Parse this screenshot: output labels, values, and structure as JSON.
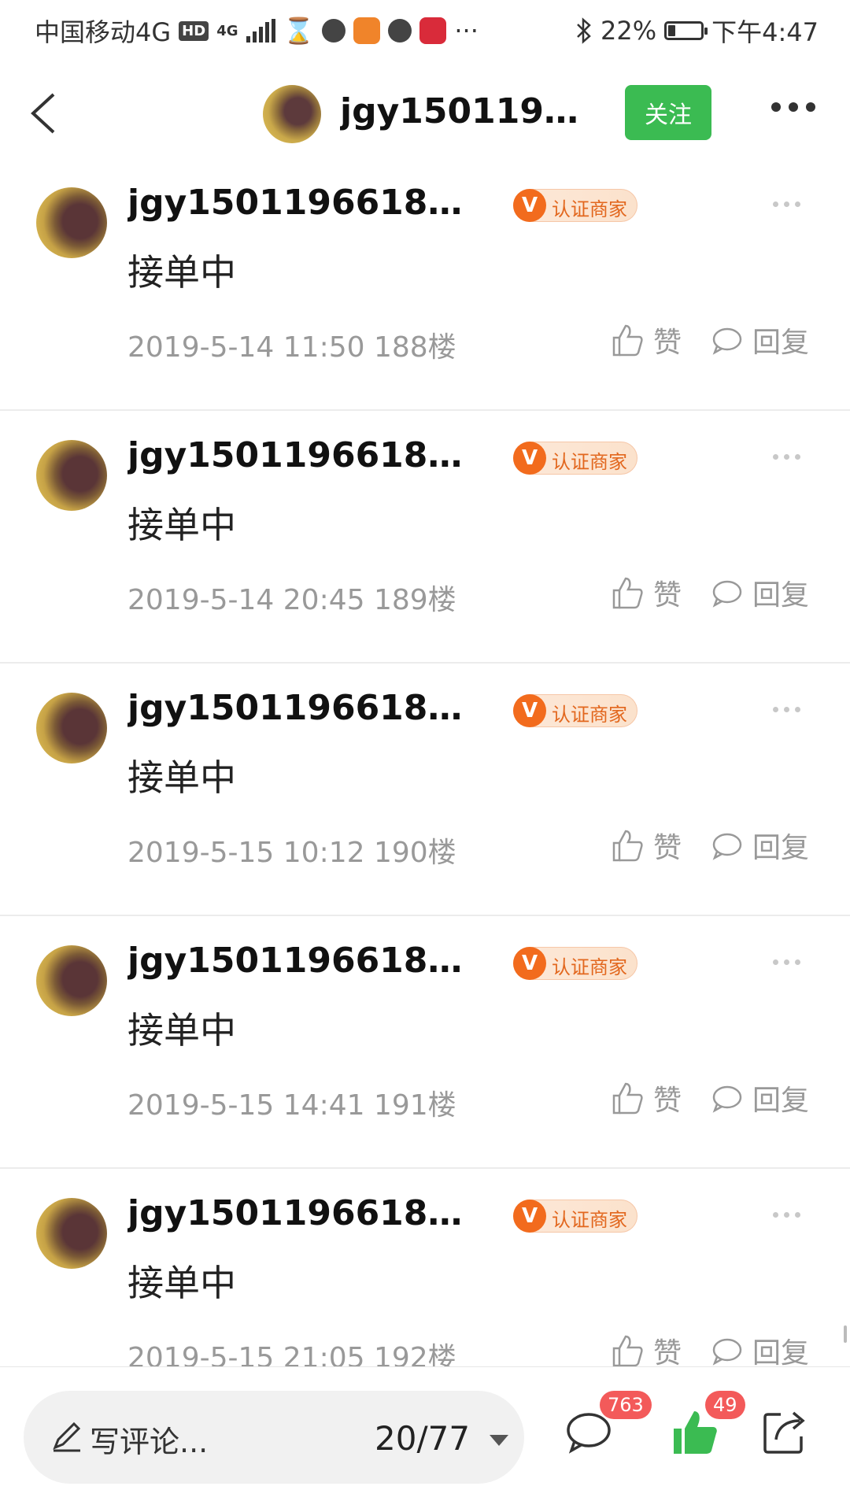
{
  "status_bar": {
    "carrier": "中国移动4G",
    "hd": "HD",
    "network": "4G",
    "more": "···",
    "battery_text": "22%",
    "battery_level": 0.22,
    "time": "下午4:47"
  },
  "header": {
    "title": "jgy15011966...",
    "follow_label": "关注"
  },
  "posts": [
    {
      "name": "jgy15011966188 (...",
      "badge_text": "认证商家",
      "badge_v": "V",
      "content": "接单中",
      "meta": "2019-5-14 11:50  188楼",
      "like_label": "赞",
      "reply_label": "回复"
    },
    {
      "name": "jgy15011966188 (...",
      "badge_text": "认证商家",
      "badge_v": "V",
      "content": "接单中",
      "meta": "2019-5-14 20:45  189楼",
      "like_label": "赞",
      "reply_label": "回复"
    },
    {
      "name": "jgy15011966188 (...",
      "badge_text": "认证商家",
      "badge_v": "V",
      "content": "接单中",
      "meta": "2019-5-15 10:12  190楼",
      "like_label": "赞",
      "reply_label": "回复"
    },
    {
      "name": "jgy15011966188 (...",
      "badge_text": "认证商家",
      "badge_v": "V",
      "content": "接单中",
      "meta": "2019-5-15 14:41  191楼",
      "like_label": "赞",
      "reply_label": "回复"
    },
    {
      "name": "jgy15011966188 (...",
      "badge_text": "认证商家",
      "badge_v": "V",
      "content": "接单中",
      "meta": "2019-5-15 21:05  192楼",
      "like_label": "赞",
      "reply_label": "回复"
    }
  ],
  "bottom_bar": {
    "placeholder": "写评论...",
    "page_indicator": "20/77",
    "comment_count": "763",
    "like_count": "49"
  },
  "colors": {
    "accent_green": "#3bbb52",
    "badge_orange": "#f26b1d",
    "count_red": "#f35a5a"
  },
  "icons": [
    "back-arrow-icon",
    "more-icon",
    "thumbs-up-icon",
    "comment-bubble-icon",
    "pen-icon",
    "dropdown-arrow-icon",
    "share-icon",
    "bluetooth-icon",
    "battery-icon"
  ]
}
